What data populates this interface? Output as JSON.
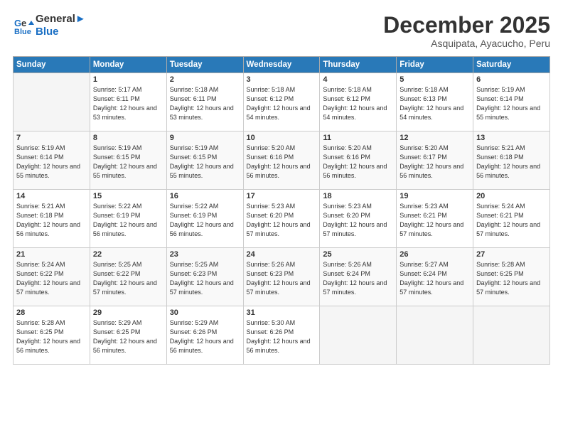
{
  "header": {
    "logo_line1": "General",
    "logo_line2": "Blue",
    "month": "December 2025",
    "location": "Asquipata, Ayacucho, Peru"
  },
  "days_of_week": [
    "Sunday",
    "Monday",
    "Tuesday",
    "Wednesday",
    "Thursday",
    "Friday",
    "Saturday"
  ],
  "weeks": [
    [
      {
        "day": "",
        "info": ""
      },
      {
        "day": "1",
        "info": "Sunrise: 5:17 AM\nSunset: 6:11 PM\nDaylight: 12 hours\nand 53 minutes."
      },
      {
        "day": "2",
        "info": "Sunrise: 5:18 AM\nSunset: 6:11 PM\nDaylight: 12 hours\nand 53 minutes."
      },
      {
        "day": "3",
        "info": "Sunrise: 5:18 AM\nSunset: 6:12 PM\nDaylight: 12 hours\nand 54 minutes."
      },
      {
        "day": "4",
        "info": "Sunrise: 5:18 AM\nSunset: 6:12 PM\nDaylight: 12 hours\nand 54 minutes."
      },
      {
        "day": "5",
        "info": "Sunrise: 5:18 AM\nSunset: 6:13 PM\nDaylight: 12 hours\nand 54 minutes."
      },
      {
        "day": "6",
        "info": "Sunrise: 5:19 AM\nSunset: 6:14 PM\nDaylight: 12 hours\nand 55 minutes."
      }
    ],
    [
      {
        "day": "7",
        "info": "Sunrise: 5:19 AM\nSunset: 6:14 PM\nDaylight: 12 hours\nand 55 minutes."
      },
      {
        "day": "8",
        "info": "Sunrise: 5:19 AM\nSunset: 6:15 PM\nDaylight: 12 hours\nand 55 minutes."
      },
      {
        "day": "9",
        "info": "Sunrise: 5:19 AM\nSunset: 6:15 PM\nDaylight: 12 hours\nand 55 minutes."
      },
      {
        "day": "10",
        "info": "Sunrise: 5:20 AM\nSunset: 6:16 PM\nDaylight: 12 hours\nand 56 minutes."
      },
      {
        "day": "11",
        "info": "Sunrise: 5:20 AM\nSunset: 6:16 PM\nDaylight: 12 hours\nand 56 minutes."
      },
      {
        "day": "12",
        "info": "Sunrise: 5:20 AM\nSunset: 6:17 PM\nDaylight: 12 hours\nand 56 minutes."
      },
      {
        "day": "13",
        "info": "Sunrise: 5:21 AM\nSunset: 6:18 PM\nDaylight: 12 hours\nand 56 minutes."
      }
    ],
    [
      {
        "day": "14",
        "info": "Sunrise: 5:21 AM\nSunset: 6:18 PM\nDaylight: 12 hours\nand 56 minutes."
      },
      {
        "day": "15",
        "info": "Sunrise: 5:22 AM\nSunset: 6:19 PM\nDaylight: 12 hours\nand 56 minutes."
      },
      {
        "day": "16",
        "info": "Sunrise: 5:22 AM\nSunset: 6:19 PM\nDaylight: 12 hours\nand 56 minutes."
      },
      {
        "day": "17",
        "info": "Sunrise: 5:23 AM\nSunset: 6:20 PM\nDaylight: 12 hours\nand 57 minutes."
      },
      {
        "day": "18",
        "info": "Sunrise: 5:23 AM\nSunset: 6:20 PM\nDaylight: 12 hours\nand 57 minutes."
      },
      {
        "day": "19",
        "info": "Sunrise: 5:23 AM\nSunset: 6:21 PM\nDaylight: 12 hours\nand 57 minutes."
      },
      {
        "day": "20",
        "info": "Sunrise: 5:24 AM\nSunset: 6:21 PM\nDaylight: 12 hours\nand 57 minutes."
      }
    ],
    [
      {
        "day": "21",
        "info": "Sunrise: 5:24 AM\nSunset: 6:22 PM\nDaylight: 12 hours\nand 57 minutes."
      },
      {
        "day": "22",
        "info": "Sunrise: 5:25 AM\nSunset: 6:22 PM\nDaylight: 12 hours\nand 57 minutes."
      },
      {
        "day": "23",
        "info": "Sunrise: 5:25 AM\nSunset: 6:23 PM\nDaylight: 12 hours\nand 57 minutes."
      },
      {
        "day": "24",
        "info": "Sunrise: 5:26 AM\nSunset: 6:23 PM\nDaylight: 12 hours\nand 57 minutes."
      },
      {
        "day": "25",
        "info": "Sunrise: 5:26 AM\nSunset: 6:24 PM\nDaylight: 12 hours\nand 57 minutes."
      },
      {
        "day": "26",
        "info": "Sunrise: 5:27 AM\nSunset: 6:24 PM\nDaylight: 12 hours\nand 57 minutes."
      },
      {
        "day": "27",
        "info": "Sunrise: 5:28 AM\nSunset: 6:25 PM\nDaylight: 12 hours\nand 57 minutes."
      }
    ],
    [
      {
        "day": "28",
        "info": "Sunrise: 5:28 AM\nSunset: 6:25 PM\nDaylight: 12 hours\nand 56 minutes."
      },
      {
        "day": "29",
        "info": "Sunrise: 5:29 AM\nSunset: 6:25 PM\nDaylight: 12 hours\nand 56 minutes."
      },
      {
        "day": "30",
        "info": "Sunrise: 5:29 AM\nSunset: 6:26 PM\nDaylight: 12 hours\nand 56 minutes."
      },
      {
        "day": "31",
        "info": "Sunrise: 5:30 AM\nSunset: 6:26 PM\nDaylight: 12 hours\nand 56 minutes."
      },
      {
        "day": "",
        "info": ""
      },
      {
        "day": "",
        "info": ""
      },
      {
        "day": "",
        "info": ""
      }
    ]
  ]
}
